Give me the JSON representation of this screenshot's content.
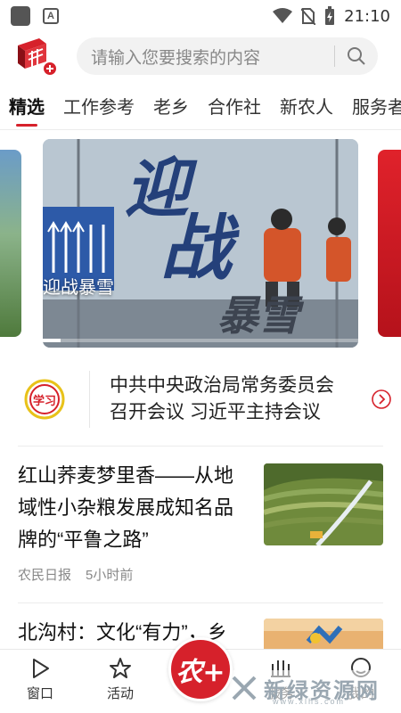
{
  "status_bar": {
    "time": "21:10",
    "notification_badge": "A"
  },
  "header": {
    "search_placeholder": "请输入您要搜索的内容",
    "logo_colors": {
      "red": "#d6212b",
      "dark": "#8a0f16"
    }
  },
  "tabs": [
    {
      "label": "精选",
      "active": true
    },
    {
      "label": "工作参考",
      "active": false
    },
    {
      "label": "老乡",
      "active": false
    },
    {
      "label": "合作社",
      "active": false
    },
    {
      "label": "新农人",
      "active": false
    },
    {
      "label": "服务者",
      "active": false
    }
  ],
  "carousel": {
    "caption": "迎战暴雪",
    "image_text_1": "迎",
    "image_text_2": "战",
    "image_text_3": "暴雪"
  },
  "ticker": {
    "badge_text": "学习",
    "line1": "中共中央政治局常务委员会",
    "line2": "召开会议 习近平主持会议"
  },
  "articles": [
    {
      "title": "红山荞麦梦里香——从地域性小杂粮发展成知名品牌的“平鲁之路”",
      "source": "农民日报",
      "time": "5小时前"
    },
    {
      "title": "北沟村：文化“有力”，乡"
    }
  ],
  "bottom_nav": {
    "items": [
      {
        "label": "窗口",
        "icon": "play-icon"
      },
      {
        "label": "活动",
        "icon": "star-icon"
      },
      {
        "label": "服务",
        "icon": "service-icon"
      },
      {
        "label": "我的",
        "icon": "profile-icon"
      }
    ],
    "center_label": "农+"
  },
  "watermark": {
    "text": "新绿资源网",
    "url": "www.xlhs.com"
  },
  "colors": {
    "accent": "#d6212b",
    "text": "#222222",
    "muted": "#888888"
  }
}
